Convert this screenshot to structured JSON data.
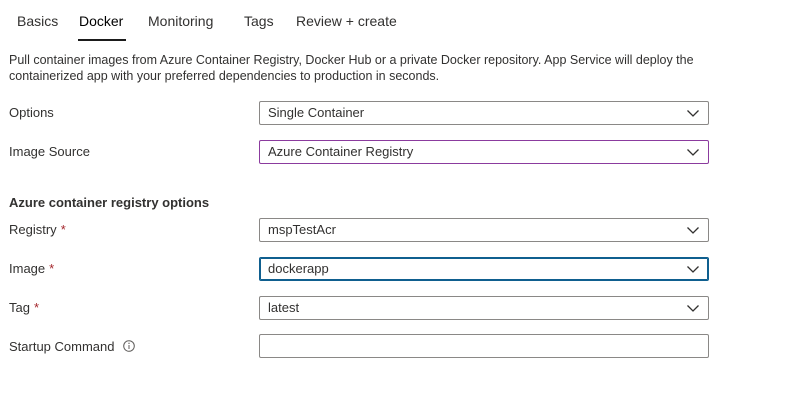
{
  "tabs": [
    {
      "label": "Basics"
    },
    {
      "label": "Docker"
    },
    {
      "label": "Monitoring"
    },
    {
      "label": "Tags"
    },
    {
      "label": "Review + create"
    }
  ],
  "description": "Pull container images from Azure Container Registry, Docker Hub or a private Docker repository. App Service will deploy the containerized app with your preferred dependencies to production in seconds.",
  "options": {
    "label": "Options",
    "value": "Single Container"
  },
  "image_source": {
    "label": "Image Source",
    "value": "Azure Container Registry"
  },
  "acr_section": {
    "heading": "Azure container registry options"
  },
  "registry": {
    "label": "Registry",
    "required": "*",
    "value": "mspTestAcr"
  },
  "image": {
    "label": "Image",
    "required": "*",
    "value": "dockerapp"
  },
  "tag": {
    "label": "Tag",
    "required": "*",
    "value": "latest"
  },
  "startup_command": {
    "label": "Startup Command",
    "value": ""
  },
  "colors": {
    "text": "#323130",
    "required": "#a4262c",
    "border": "#8a8886",
    "focus_border": "#0f5f8f",
    "hover_border": "#8b3b9e"
  },
  "icons": {
    "dropdown": "chevron-down-icon",
    "info": "info-icon"
  }
}
